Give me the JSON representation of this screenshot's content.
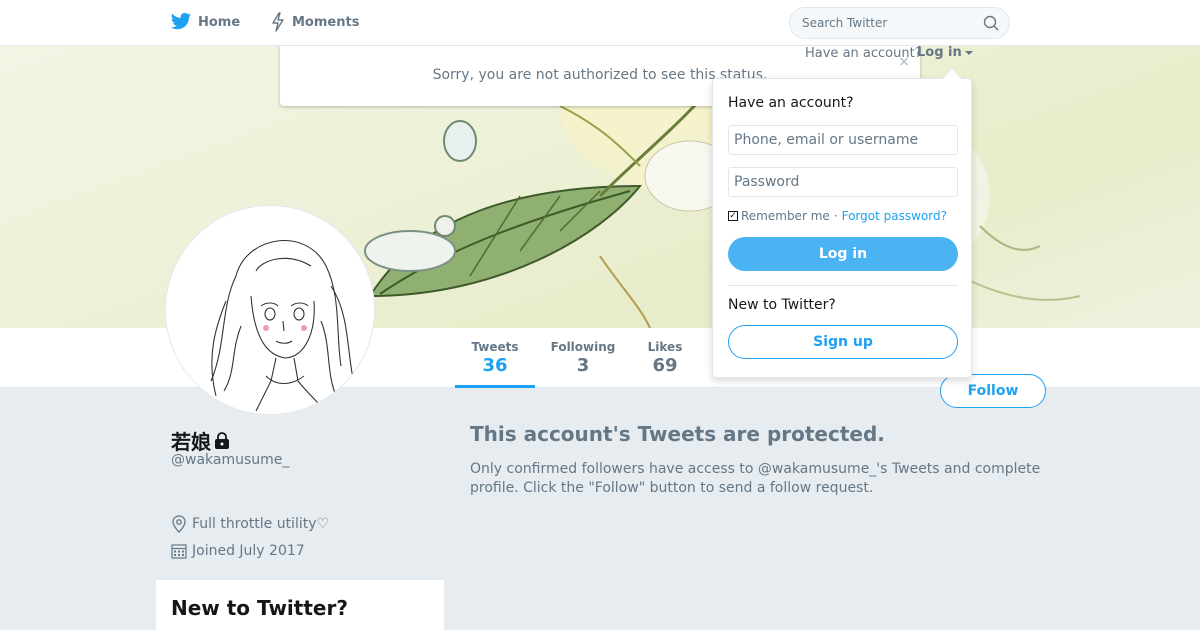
{
  "nav": {
    "home_label": "Home",
    "moments_label": "Moments",
    "search_placeholder": "Search Twitter"
  },
  "notice": {
    "message": "Sorry, you are not authorized to see this status.",
    "close_glyph": "×"
  },
  "login_header": {
    "have_account": "Have an account?",
    "login_label": "Log in"
  },
  "login_dropdown": {
    "heading": "Have an account?",
    "username_placeholder": "Phone, email or username",
    "password_placeholder": "Password",
    "remember_me": "Remember me",
    "separator": "·",
    "forgot_password": "Forgot password?",
    "login_button": "Log in",
    "new_to_twitter": "New to Twitter?",
    "signup_button": "Sign up",
    "remember_checked": true
  },
  "profile_nav": {
    "stats": [
      {
        "label": "Tweets",
        "value": "36"
      },
      {
        "label": "Following",
        "value": "3"
      },
      {
        "label": "Likes",
        "value": "69"
      }
    ],
    "active_tab": "Tweets"
  },
  "follow_button": "Follow",
  "profile": {
    "display_name": "若娘",
    "screen_name": "@wakamusume_",
    "location": "Full throttle utility♡",
    "joined": "Joined July 2017",
    "protected": true
  },
  "protected": {
    "title": "This account's Tweets are protected.",
    "body": "Only confirmed followers have access to @wakamusume_'s Tweets and complete profile. Click the \"Follow\" button to send a follow request."
  },
  "sidebar": {
    "new_to_twitter": "New to Twitter?"
  },
  "colors": {
    "brand": "#1da1f2",
    "background": "#e6ecf0",
    "text_secondary": "#657786"
  }
}
